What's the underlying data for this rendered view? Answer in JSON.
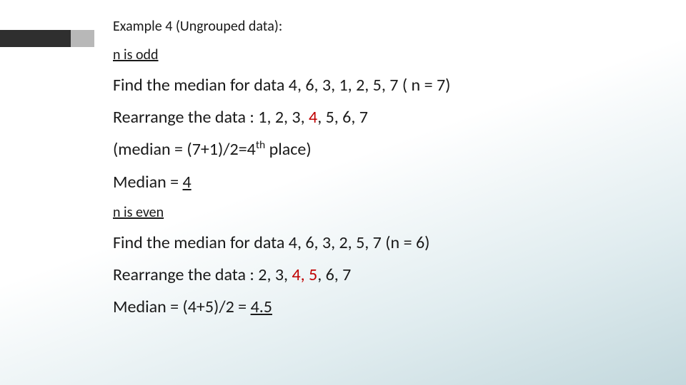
{
  "slide": {
    "title": "Example 4 (Ungrouped data):",
    "odd": {
      "heading": "n is odd",
      "lines": {
        "find": "Find the median for data 4, 6, 3, 1, 2, 5, 7 ( n = 7)",
        "rearrange_pre": "Rearrange the data : 1, 2, 3, ",
        "rearrange_mid": "4",
        "rearrange_post": ", 5, 6, 7",
        "formula_pre": "(median = (7+1)/2=4",
        "formula_sup": "th",
        "formula_post": " place)",
        "result_pre": "Median = ",
        "result_val": "4"
      }
    },
    "even": {
      "heading": "n is even",
      "lines": {
        "find": "Find the median for data 4, 6, 3, 2, 5, 7 (n = 6)",
        "rearrange_pre": "Rearrange the data : 2, 3, ",
        "rearrange_mid": "4, 5",
        "rearrange_post": ", 6, 7",
        "result_pre": "Median = (4+5)/2 = ",
        "result_val": "4.5"
      }
    }
  }
}
